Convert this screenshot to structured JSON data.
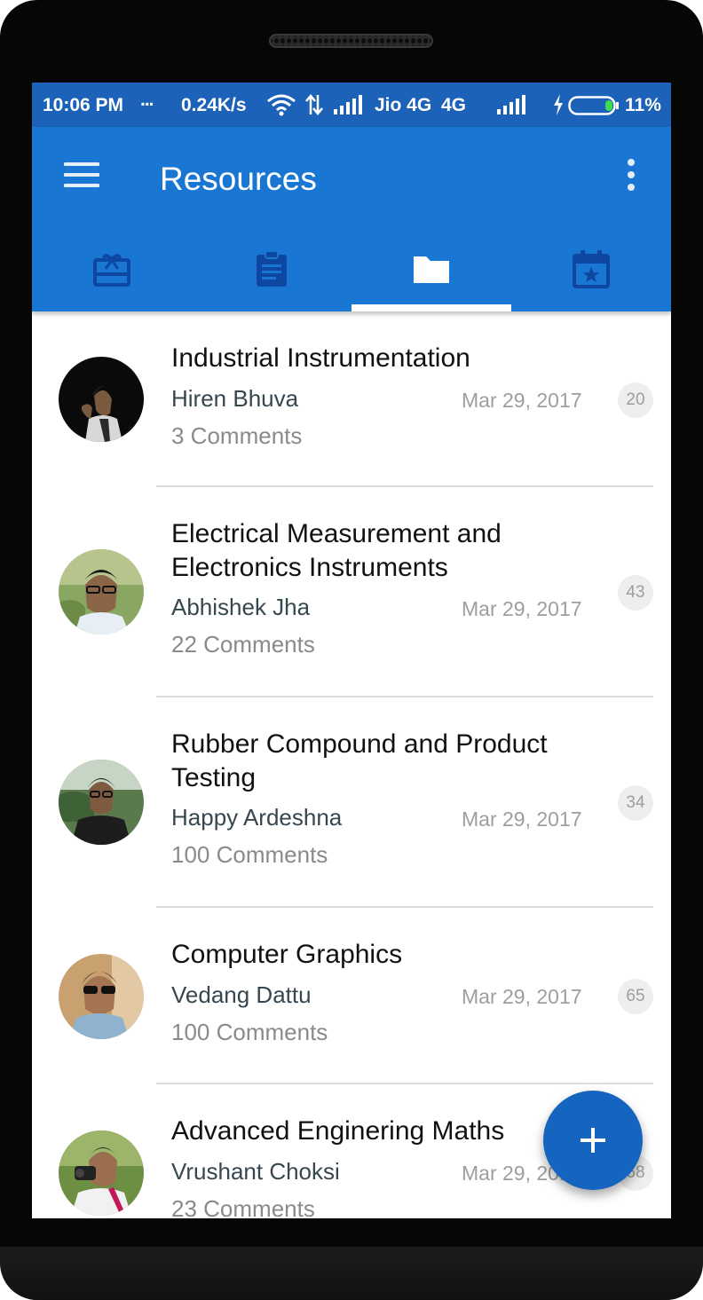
{
  "status_bar": {
    "time": "10:06 PM",
    "dots": "...",
    "net_speed": "0.24K/s",
    "carrier": "Jio 4G",
    "network_type": "4G",
    "battery_level": "11%",
    "icons": [
      "wifi-icon",
      "data-arrows-icon",
      "signal-icon",
      "signal-icon",
      "charging-icon",
      "battery-icon"
    ]
  },
  "app_bar": {
    "title": "Resources",
    "color": "#1976d2",
    "menu_icon": "hamburger-menu-icon",
    "more_icon": "more-vert-icon"
  },
  "tabs": [
    {
      "icon": "card-giftcard-icon",
      "selected": false
    },
    {
      "icon": "assignment-icon",
      "selected": false
    },
    {
      "icon": "folder-icon",
      "selected": true
    },
    {
      "icon": "event-star-icon",
      "selected": false
    }
  ],
  "resources": [
    {
      "title": "Industrial Instrumentation",
      "author": "Hiren Bhuva",
      "date": "Mar 29, 2017",
      "comments": "3 Comments",
      "badge": "20"
    },
    {
      "title": "Electrical Measurement and Electronics Instruments",
      "author": "Abhishek Jha",
      "date": "Mar 29, 2017",
      "comments": "22 Comments",
      "badge": "43"
    },
    {
      "title": "Rubber Compound and Product Testing",
      "author": "Happy Ardeshna",
      "date": "Mar 29, 2017",
      "comments": "100 Comments",
      "badge": "34"
    },
    {
      "title": "Computer Graphics",
      "author": "Vedang Dattu",
      "date": "Mar 29, 2017",
      "comments": "100 Comments",
      "badge": "65"
    },
    {
      "title": "Advanced Enginering Maths",
      "author": "Vrushant Choksi",
      "date": "Mar 29, 2017",
      "comments": "23 Comments",
      "badge": "68"
    }
  ],
  "fab": {
    "icon": "add-icon",
    "color": "#1565c0"
  }
}
